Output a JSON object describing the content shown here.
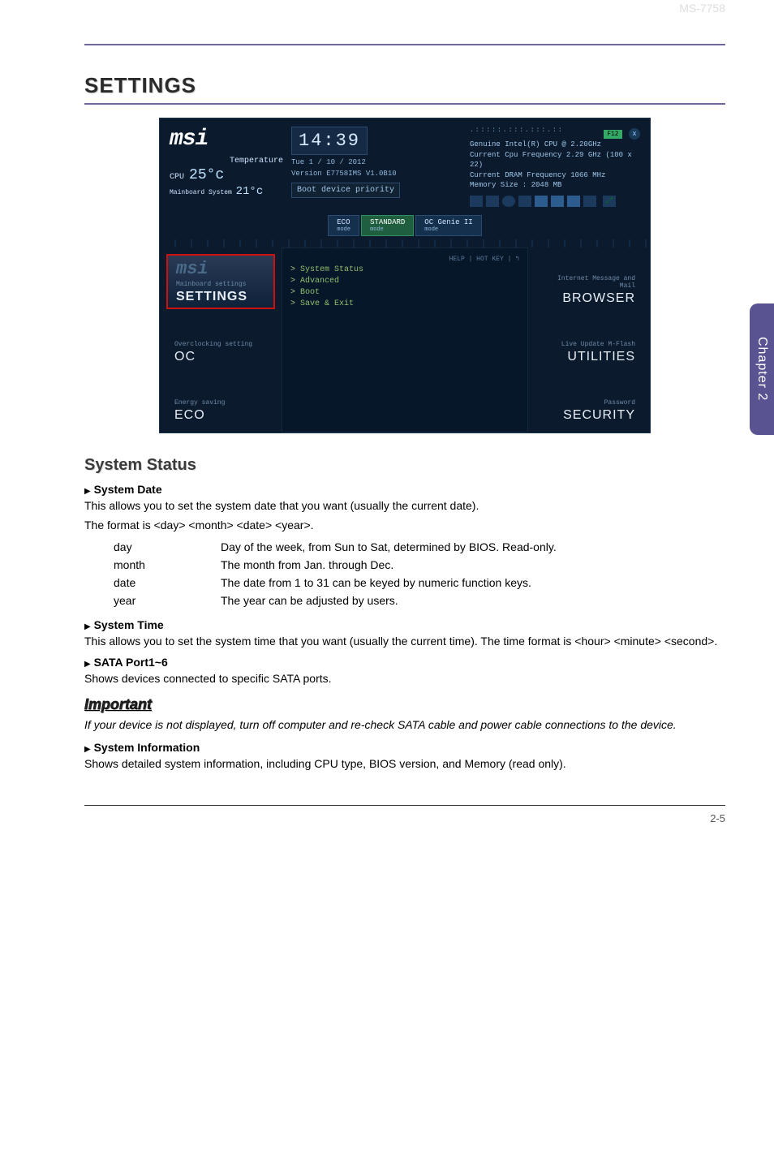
{
  "doc_id": "MS-7758",
  "sidebar": "Chapter 2",
  "h1": "SETTINGS",
  "bios": {
    "logo": "msi",
    "temp_label": "Temperature",
    "cpu_label": "CPU",
    "cpu_temp": "25°c",
    "mb_label": "Mainboard System",
    "mb_temp": "21°c",
    "clock": "14:39",
    "date": "Tue  1 / 10 / 2012",
    "version": "Version E7758IMS V1.0B10",
    "boot_btn": "Boot device priority",
    "f12": "F12",
    "cpu_name": "Genuine Intel(R) CPU @ 2.20GHz",
    "cpu_freq": "Current Cpu Frequency 2.29 GHz (100 x 22)",
    "dram": "Current DRAM Frequency 1066 MHz",
    "mem": "Memory Size : 2048 MB",
    "modes": {
      "eco": "ECO",
      "std": "STANDARD",
      "ocg": "OC Genie II",
      "mode": "mode"
    },
    "menu": [
      "System Status",
      "Advanced",
      "Boot",
      "Save & Exit"
    ],
    "hotkey": "HELP | HOT KEY | ↰",
    "left": [
      {
        "sub": "Mainboard settings",
        "main": "SETTINGS",
        "selected": true
      },
      {
        "sub": "Overclocking setting",
        "main": "OC"
      },
      {
        "sub": "Energy saving",
        "main": "ECO"
      }
    ],
    "right": [
      {
        "sub": "Internet Message and Mail",
        "main": "BROWSER"
      },
      {
        "sub": "Live Update   M-Flash",
        "main": "UTILITIES"
      },
      {
        "sub": "Password",
        "main": "SECURITY"
      }
    ]
  },
  "sys_status": {
    "heading": "System Status",
    "date_hd": "System Date",
    "date_p1": "This allows you to set the system date that you want (usually the current date).",
    "date_p2": "The format is <day> <month> <date> <year>.",
    "rows": [
      {
        "k": "day",
        "v": "Day of the week, from Sun to Sat, determined by BIOS. Read-only."
      },
      {
        "k": "month",
        "v": "The month from Jan. through Dec."
      },
      {
        "k": "date",
        "v": "The date from 1 to 31 can be keyed by numeric function keys."
      },
      {
        "k": "year",
        "v": "The year can be adjusted by users."
      }
    ],
    "time_hd": "System Time",
    "time_p": "This allows you to set the system time that you want (usually the current time). The time format is <hour> <minute> <second>.",
    "sata_hd": "SATA Port1~6",
    "sata_p": "Shows devices connected to specific SATA ports.",
    "imp": "Important",
    "imp_p": "If your device is not displayed, turn off computer and re-check SATA cable and power cable connections to the device.",
    "info_hd": "System Information",
    "info_p": "Shows detailed system information, including CPU type, BIOS version, and Memory (read only)."
  },
  "page_num": "2-5"
}
